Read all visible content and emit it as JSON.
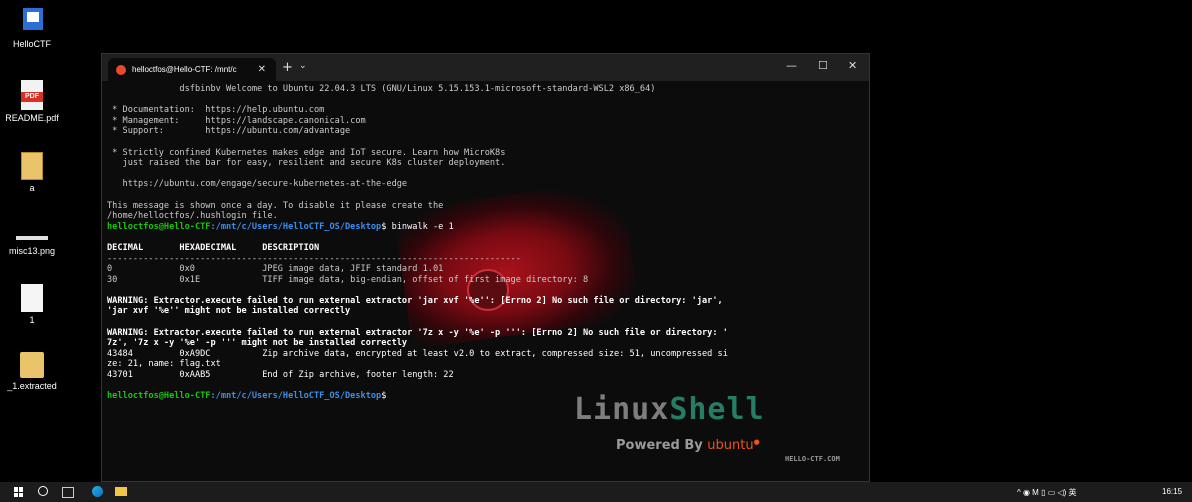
{
  "desktop": {
    "icons": [
      {
        "label": "HelloCTF"
      },
      {
        "label": "README.pdf"
      },
      {
        "label": "a"
      },
      {
        "label": "misc13.png"
      },
      {
        "label": "1"
      },
      {
        "label": "_1.extracted"
      }
    ],
    "pdf_badge": "PDF"
  },
  "terminal": {
    "tab_title": "helloctfos@Hello-CTF: /mnt/c",
    "tab_close": "✕",
    "new_tab": "+",
    "tab_dropdown": "⌄",
    "minimize": "—",
    "maximize": "☐",
    "close": "✕",
    "lines": [
      "              dsfbinbv Welcome to Ubuntu 22.04.3 LTS (GNU/Linux 5.15.153.1-microsoft-standard-WSL2 x86_64)",
      "",
      " * Documentation:  https://help.ubuntu.com",
      " * Management:     https://landscape.canonical.com",
      " * Support:        https://ubuntu.com/advantage",
      "",
      " * Strictly confined Kubernetes makes edge and IoT secure. Learn how MicroK8s",
      "   just raised the bar for easy, resilient and secure K8s cluster deployment.",
      "",
      "   https://ubuntu.com/engage/secure-kubernetes-at-the-edge",
      "",
      "This message is shown once a day. To disable it please create the",
      "/home/helloctfos/.hushlogin file."
    ],
    "prompt1": {
      "user": "helloctfos@Hello-CTF",
      "path": ":/mnt/c/Users/HelloCTF_OS/Desktop",
      "cmd": "$ binwalk -e 1"
    },
    "table_header": "DECIMAL       HEXADECIMAL     DESCRIPTION",
    "table_rule": "--------------------------------------------------------------------------------",
    "rows": [
      "0             0x0             JPEG image data, JFIF standard 1.01",
      "30            0x1E            TIFF image data, big-endian, offset of first image directory: 8"
    ],
    "warning1": [
      "WARNING: Extractor.execute failed to run external extractor 'jar xvf '%e'': [Errno 2] No such file or directory: 'jar',",
      "'jar xvf '%e'' might not be installed correctly"
    ],
    "warning2": [
      "WARNING: Extractor.execute failed to run external extractor '7z x -y '%e' -p ''': [Errno 2] No such file or directory: '",
      "7z', '7z x -y '%e' -p ''' might not be installed correctly",
      "43484         0xA9DC          Zip archive data, encrypted at least v2.0 to extract, compressed size: 51, uncompressed si",
      "ze: 21, name: flag.txt",
      "43701         0xAAB5          End of Zip archive, footer length: 22"
    ],
    "prompt2": {
      "user": "helloctfos@Hello-CTF",
      "path": ":/mnt/c/Users/HelloCTF_OS/Desktop",
      "cmd": "$"
    },
    "background": {
      "brand_a": "Linux",
      "brand_b": "Shell",
      "powered": "Powered By ",
      "powered_brand": "ubuntu",
      "site": "HELLO-CTF.COM"
    }
  },
  "taskbar": {
    "tray_text": "^  ◉  M  ▯  ▭  ◁)  英",
    "time": "16:15"
  },
  "colors": {
    "prompt_user": "#16c60c",
    "prompt_path": "#3b8eea",
    "terminal_bg": "#0c0c0c",
    "accent": "#e95420"
  }
}
